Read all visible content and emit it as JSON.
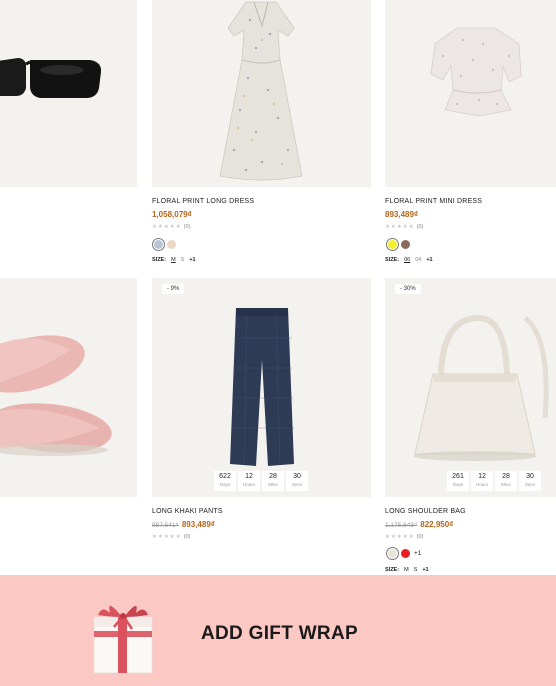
{
  "products": [
    {
      "id": "sunglasses",
      "title": "",
      "price": "",
      "rating": "",
      "colors": []
    },
    {
      "id": "floral-long-dress",
      "title": "FLORAL PRINT LONG DRESS",
      "price": "1,058,079₫",
      "rating_count": "(0)",
      "colors": [
        "#b9c6d6",
        "#ead8c4"
      ],
      "size_label": "SIZE:",
      "sizes": [
        "M",
        "S"
      ],
      "sizes_more": "+1"
    },
    {
      "id": "floral-mini-dress",
      "title": "FLORAL PRINT MINI DRESS",
      "price": "893,489₫",
      "rating_count": "(0)",
      "colors": [
        "#f3ef2a",
        "#8a6a5a"
      ],
      "size_label": "SIZE:",
      "sizes": [
        "06",
        "04"
      ],
      "sizes_more": "+1"
    },
    {
      "id": "slippers",
      "title": "",
      "price": ""
    },
    {
      "id": "long-khaki-pants",
      "badge": "- 9%",
      "timer": [
        {
          "value": "622",
          "unit": "Days"
        },
        {
          "value": "12",
          "unit": "Hours"
        },
        {
          "value": "28",
          "unit": "Mins"
        },
        {
          "value": "30",
          "unit": "Secs"
        }
      ],
      "title": "LONG KHAKI PANTS",
      "old_price": "987,541₫",
      "price": "893,489₫",
      "rating_count": "(0)"
    },
    {
      "id": "long-shoulder-bag",
      "badge": "- 30%",
      "timer": [
        {
          "value": "261",
          "unit": "Days"
        },
        {
          "value": "12",
          "unit": "Hours"
        },
        {
          "value": "28",
          "unit": "Mins"
        },
        {
          "value": "30",
          "unit": "Secs"
        }
      ],
      "title": "LONG SHOULDER BAG",
      "old_price": "1,175,643₫",
      "price": "822,950₫",
      "rating_count": "(0)",
      "colors": [
        "#e9e4da",
        "#e62020"
      ],
      "colors_more": "+1",
      "size_label": "SIZE:",
      "sizes": [
        "M",
        "S"
      ],
      "sizes_more": "+1"
    }
  ],
  "gift": {
    "label": "ADD GIFT WRAP"
  },
  "stars": "★★★★★",
  "colors": {
    "price": "#b5651d",
    "banner_bg": "#fbc8c4",
    "card_bg": "#f4f2ee"
  }
}
